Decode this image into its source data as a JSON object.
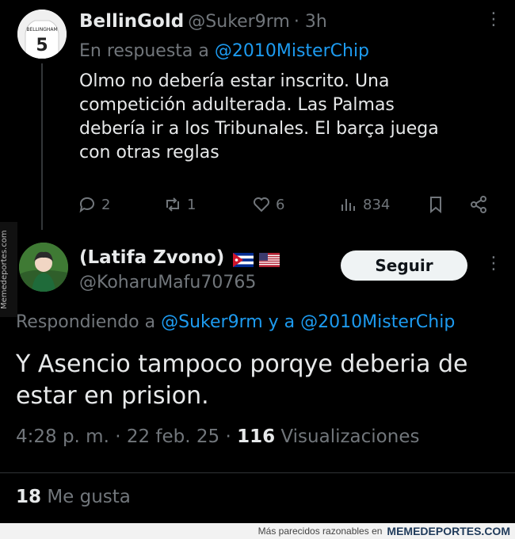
{
  "tweet1": {
    "name": "BellinGold",
    "handle": "@Suker9rm",
    "time": "· 3h",
    "reply_prefix": "En respuesta a",
    "reply_target": "@2010MisterChip",
    "text_lines": [
      "Olmo no debería estar inscrito. Una",
      "competición adulterada. Las Palmas",
      "debería ir a los Tribunales. El barça juega",
      "con otras reglas"
    ],
    "avatar_jersey_name": "BELLINGHAM",
    "avatar_jersey_number": "5",
    "actions": {
      "replies": "2",
      "retweets": "1",
      "likes": "6",
      "views": "834"
    }
  },
  "tweet2": {
    "name": "(Latifa Zvono)",
    "handle": "@KoharuMafu70765",
    "follow_label": "Seguir",
    "replying_prefix": "Respondiendo a",
    "replying_user1": "@Suker9rm",
    "replying_and": "y a",
    "replying_user2": "@2010MisterChip",
    "text_line1": "Y Asencio tampoco porqye deberia de",
    "text_line2": "estar en prision.",
    "meta_time": "4:28 p. m. · 22 feb. 25 ·",
    "views_count": "116",
    "views_label": "Visualizaciones",
    "likes_count": "18",
    "likes_label": "Me gusta"
  },
  "watermark": "Memedeportes.com",
  "footer": {
    "text": "Más parecidos razonables en",
    "brand": "MEMEDEPORTES.COM"
  },
  "colors": {
    "background": "#000000",
    "link": "#1d9bf0",
    "muted": "#71767b",
    "text": "#e7e9ea"
  }
}
